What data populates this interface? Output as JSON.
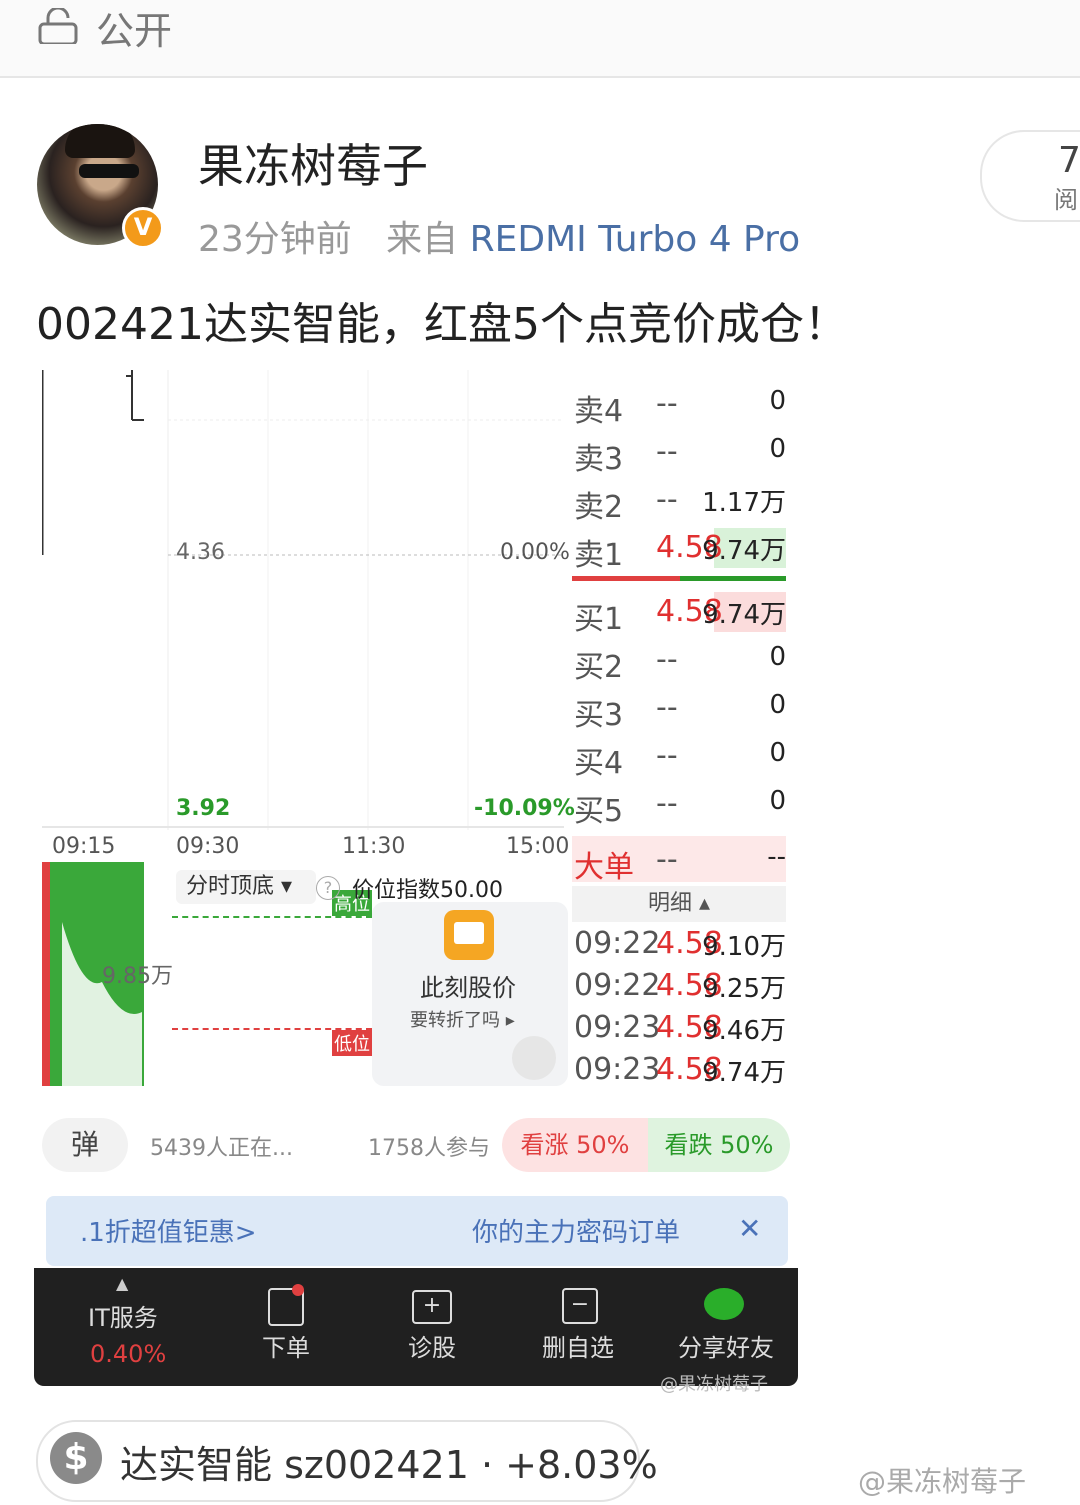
{
  "header": {
    "lock_icon": "lock-icon",
    "visibility": "公开"
  },
  "post": {
    "author": "果冻树莓子",
    "verified_badge": "V",
    "time": "23分钟前",
    "source_prefix": "来自",
    "device": "REDMI Turbo 4 Pro",
    "read_count": "7",
    "read_label": "阅",
    "text": "002421达实智能，红盘5个点竞价成仓！"
  },
  "screenshot": {
    "chart": {
      "price_top": "4.36",
      "pct_top": "0.00%",
      "price_bottom": "3.92",
      "pct_bottom": "-10.09%",
      "times": [
        "09:15",
        "09:30",
        "11:30",
        "15:00"
      ],
      "volume_label": "9.85万",
      "indicator_dropdown": "分时顶底",
      "indicator_value": "价位指数50.00",
      "high_tag": "高位",
      "low_tag": "低位",
      "promo_title": "此刻股价",
      "promo_sub": "要转折了吗"
    },
    "orderbook": {
      "sell": [
        {
          "label": "卖4",
          "price": "--",
          "vol": "0"
        },
        {
          "label": "卖3",
          "price": "--",
          "vol": "0"
        },
        {
          "label": "卖2",
          "price": "--",
          "vol": "1.17万"
        },
        {
          "label": "卖1",
          "price": "4.58",
          "vol": "9.74万"
        }
      ],
      "buy": [
        {
          "label": "买1",
          "price": "4.58",
          "vol": "9.74万"
        },
        {
          "label": "买2",
          "price": "--",
          "vol": "0"
        },
        {
          "label": "买3",
          "price": "--",
          "vol": "0"
        },
        {
          "label": "买4",
          "price": "--",
          "vol": "0"
        },
        {
          "label": "买5",
          "price": "--",
          "vol": "0"
        }
      ],
      "big_order": {
        "label": "大单",
        "price": "--",
        "vol": "--"
      },
      "detail_label": "明细",
      "ticks": [
        {
          "time": "09:22",
          "price": "4.58",
          "vol": "9.10万"
        },
        {
          "time": "09:22",
          "price": "4.58",
          "vol": "9.25万"
        },
        {
          "time": "09:23",
          "price": "4.58",
          "vol": "9.46万"
        },
        {
          "time": "09:23",
          "price": "4.58",
          "vol": "9.74万"
        }
      ]
    },
    "vote": {
      "danmu": "弹",
      "watching": "5439人正在...",
      "participants": "1758人参与",
      "bull": "看涨 50%",
      "bear": "看跌 50%"
    },
    "banner": {
      "left": ".1折超值钜惠>",
      "right": "你的主力密码订单"
    },
    "bottom_bar": {
      "items": [
        "IT服务",
        "下单",
        "诊股",
        "删自选",
        "分享好友"
      ],
      "sector_pct": "0.40%"
    },
    "watermark_inner": "@果冻树莓子"
  },
  "stock_chip": {
    "text": "达实智能 sz002421 · +8.03%"
  },
  "watermark": "@果冻树莓子"
}
